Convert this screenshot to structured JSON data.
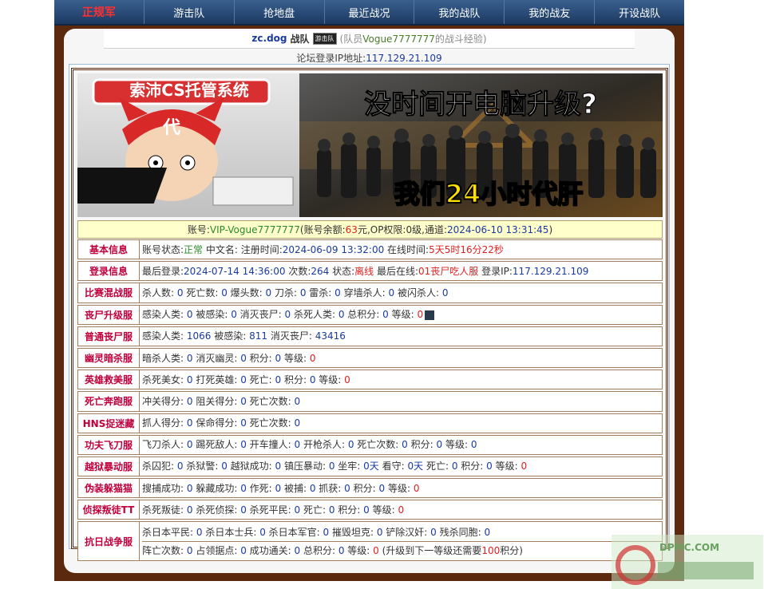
{
  "nav": {
    "logo": "正规军",
    "items": [
      "游击队",
      "抢地盘",
      "最近战况",
      "我的战队",
      "我的战友",
      "开设战队"
    ]
  },
  "header": {
    "team": "zc.dog",
    "team_suffix": "战队",
    "badge": "游击队",
    "member_prefix": "(队员",
    "member_name": "Vogue7777777",
    "member_suffix": "的战斗经验)"
  },
  "ip": {
    "label": "论坛登录IP地址:",
    "value": "117.129.21.109"
  },
  "banner": {
    "brand": "索沛CS托管系统",
    "badge_char": "代",
    "headline": "没时间开电脑升级?",
    "slogan": "我们24小时代肝"
  },
  "account": {
    "p1": "账号:",
    "name": "VIP-Vogue7777777",
    "p2": "(账号余额:",
    "balance": "63",
    "p3": "元,OP权限:",
    "op": "0级",
    "p4": ",通道:",
    "channel": "2024-06-10 13:31:45",
    "p5": ")"
  },
  "sections": [
    {
      "label": "基本信息",
      "lines": [
        [
          {
            "t": "账号状态:"
          },
          {
            "t": "正常",
            "c": "g"
          },
          {
            "t": " 中文名: 注册时间:"
          },
          {
            "t": "2024-06-09 13:32:00",
            "c": "b"
          },
          {
            "t": " 在线时间:"
          },
          {
            "t": "5天5时16分22秒",
            "c": "r"
          }
        ]
      ]
    },
    {
      "label": "登录信息",
      "lines": [
        [
          {
            "t": "最后登录:"
          },
          {
            "t": "2024-07-14 14:36:00",
            "c": "b"
          },
          {
            "t": " 次数:"
          },
          {
            "t": "264",
            "c": "b"
          },
          {
            "t": " 状态:"
          },
          {
            "t": "离线",
            "c": "r"
          },
          {
            "t": " 最后在线:"
          },
          {
            "t": "01丧尸吃人服",
            "c": "r"
          },
          {
            "t": " 登录IP:"
          },
          {
            "t": "117.129.21.109",
            "c": "b"
          }
        ]
      ]
    },
    {
      "label": "比赛混战服",
      "lines": [
        [
          {
            "t": "杀人数: "
          },
          {
            "t": "0",
            "c": "b"
          },
          {
            "t": " 死亡数: "
          },
          {
            "t": "0",
            "c": "b"
          },
          {
            "t": " 爆头数: "
          },
          {
            "t": "0",
            "c": "b"
          },
          {
            "t": " 刀杀: "
          },
          {
            "t": "0",
            "c": "b"
          },
          {
            "t": " 雷杀: "
          },
          {
            "t": "0",
            "c": "b"
          },
          {
            "t": " 穿墙杀人: "
          },
          {
            "t": "0",
            "c": "b"
          },
          {
            "t": " 被闪杀人: "
          },
          {
            "t": "0",
            "c": "b"
          }
        ]
      ]
    },
    {
      "label": "丧尸升级服",
      "lines": [
        [
          {
            "t": "感染人类: "
          },
          {
            "t": "0",
            "c": "b"
          },
          {
            "t": " 被感染: "
          },
          {
            "t": "0",
            "c": "b"
          },
          {
            "t": " 消灭丧尸: "
          },
          {
            "t": "0",
            "c": "b"
          },
          {
            "t": " 杀死人类: "
          },
          {
            "t": "0",
            "c": "b"
          },
          {
            "t": " 总积分: "
          },
          {
            "t": "0",
            "c": "b"
          },
          {
            "t": " 等级: "
          },
          {
            "t": "0",
            "c": "r"
          }
        ]
      ],
      "icon": true
    },
    {
      "label": "普通丧尸服",
      "lines": [
        [
          {
            "t": "感染人类: "
          },
          {
            "t": "1066",
            "c": "b"
          },
          {
            "t": " 被感染: "
          },
          {
            "t": "811",
            "c": "b"
          },
          {
            "t": " 消灭丧尸: "
          },
          {
            "t": "43416",
            "c": "b"
          }
        ]
      ]
    },
    {
      "label": "幽灵暗杀服",
      "lines": [
        [
          {
            "t": "暗杀人类: "
          },
          {
            "t": "0",
            "c": "b"
          },
          {
            "t": " 消灭幽灵: "
          },
          {
            "t": "0",
            "c": "b"
          },
          {
            "t": " 积分: "
          },
          {
            "t": "0",
            "c": "b"
          },
          {
            "t": " 等级: "
          },
          {
            "t": "0",
            "c": "r"
          }
        ]
      ]
    },
    {
      "label": "英雄救美服",
      "lines": [
        [
          {
            "t": "杀死美女: "
          },
          {
            "t": "0",
            "c": "b"
          },
          {
            "t": " 打死英雄: "
          },
          {
            "t": "0",
            "c": "b"
          },
          {
            "t": " 死亡: "
          },
          {
            "t": "0",
            "c": "b"
          },
          {
            "t": " 积分: "
          },
          {
            "t": "0",
            "c": "b"
          },
          {
            "t": " 等级: "
          },
          {
            "t": "0",
            "c": "r"
          }
        ]
      ]
    },
    {
      "label": "死亡奔跑服",
      "lines": [
        [
          {
            "t": "冲关得分: "
          },
          {
            "t": "0",
            "c": "b"
          },
          {
            "t": " 阻关得分: "
          },
          {
            "t": "0",
            "c": "b"
          },
          {
            "t": " 死亡次数: "
          },
          {
            "t": "0",
            "c": "b"
          }
        ]
      ]
    },
    {
      "label": "HNS捉迷藏",
      "lines": [
        [
          {
            "t": "抓人得分: "
          },
          {
            "t": "0",
            "c": "b"
          },
          {
            "t": " 保命得分: "
          },
          {
            "t": "0",
            "c": "b"
          },
          {
            "t": " 死亡次数: "
          },
          {
            "t": "0",
            "c": "b"
          }
        ]
      ]
    },
    {
      "label": "功夫飞刀服",
      "lines": [
        [
          {
            "t": "飞刀杀人: "
          },
          {
            "t": "0",
            "c": "b"
          },
          {
            "t": " 踢死敌人: "
          },
          {
            "t": "0",
            "c": "b"
          },
          {
            "t": " 开车撞人: "
          },
          {
            "t": "0",
            "c": "b"
          },
          {
            "t": " 开枪杀人: "
          },
          {
            "t": "0",
            "c": "b"
          },
          {
            "t": " 死亡次数: "
          },
          {
            "t": "0",
            "c": "b"
          },
          {
            "t": " 积分: "
          },
          {
            "t": "0",
            "c": "b"
          },
          {
            "t": " 等级: "
          },
          {
            "t": "0",
            "c": "b"
          }
        ]
      ]
    },
    {
      "label": "越狱暴动服",
      "lines": [
        [
          {
            "t": "杀囚犯: "
          },
          {
            "t": "0",
            "c": "b"
          },
          {
            "t": " 杀狱警: "
          },
          {
            "t": "0",
            "c": "b"
          },
          {
            "t": " 越狱成功: "
          },
          {
            "t": "0",
            "c": "b"
          },
          {
            "t": " 镇压暴动: "
          },
          {
            "t": "0",
            "c": "b"
          },
          {
            "t": " 坐牢: "
          },
          {
            "t": "0天",
            "c": "b"
          },
          {
            "t": " 看守: "
          },
          {
            "t": "0天",
            "c": "b"
          },
          {
            "t": " 死亡: "
          },
          {
            "t": "0",
            "c": "b"
          },
          {
            "t": " 积分: "
          },
          {
            "t": "0",
            "c": "b"
          },
          {
            "t": " 等级: "
          },
          {
            "t": "0",
            "c": "r"
          }
        ]
      ]
    },
    {
      "label": "伪装躲猫猫",
      "lines": [
        [
          {
            "t": "搜捕成功: "
          },
          {
            "t": "0",
            "c": "b"
          },
          {
            "t": " 躲藏成功: "
          },
          {
            "t": "0",
            "c": "b"
          },
          {
            "t": " 作死: "
          },
          {
            "t": "0",
            "c": "b"
          },
          {
            "t": " 被捕: "
          },
          {
            "t": "0",
            "c": "b"
          },
          {
            "t": " 抓获: "
          },
          {
            "t": "0",
            "c": "b"
          },
          {
            "t": " 积分: "
          },
          {
            "t": "0",
            "c": "b"
          },
          {
            "t": " 等级: "
          },
          {
            "t": "0",
            "c": "r"
          }
        ]
      ]
    },
    {
      "label": "侦探叛徒TT",
      "lines": [
        [
          {
            "t": "杀死叛徒: "
          },
          {
            "t": "0",
            "c": "b"
          },
          {
            "t": " 杀死侦探: "
          },
          {
            "t": "0",
            "c": "b"
          },
          {
            "t": " 杀死平民: "
          },
          {
            "t": "0",
            "c": "b"
          },
          {
            "t": " 死亡: "
          },
          {
            "t": "0",
            "c": "b"
          },
          {
            "t": " 积分: "
          },
          {
            "t": "0",
            "c": "b"
          },
          {
            "t": " 等级: "
          },
          {
            "t": "0",
            "c": "r"
          }
        ]
      ]
    },
    {
      "label": "抗日战争服",
      "tall": true,
      "lines": [
        [
          {
            "t": "杀日本平民: "
          },
          {
            "t": "0",
            "c": "b"
          },
          {
            "t": " 杀日本士兵: "
          },
          {
            "t": "0",
            "c": "b"
          },
          {
            "t": " 杀日本军官: "
          },
          {
            "t": "0",
            "c": "b"
          },
          {
            "t": " 摧毁坦克: "
          },
          {
            "t": "0",
            "c": "b"
          },
          {
            "t": " 铲除汉奸: "
          },
          {
            "t": "0",
            "c": "b"
          },
          {
            "t": " 残杀同胞: "
          },
          {
            "t": "0",
            "c": "b"
          }
        ],
        [
          {
            "t": "阵亡次数: "
          },
          {
            "t": "0",
            "c": "b"
          },
          {
            "t": " 占领据点: "
          },
          {
            "t": "0",
            "c": "b"
          },
          {
            "t": " 成功通关: "
          },
          {
            "t": "0",
            "c": "b"
          },
          {
            "t": " 总积分: "
          },
          {
            "t": "0",
            "c": "b"
          },
          {
            "t": " 等级: "
          },
          {
            "t": "0",
            "c": "r"
          },
          {
            "t": " (升级到下一等级还需要"
          },
          {
            "t": "100",
            "c": "r"
          },
          {
            "t": "积分)"
          }
        ]
      ]
    }
  ],
  "watermark": {
    "text": "DPMC.COM"
  }
}
